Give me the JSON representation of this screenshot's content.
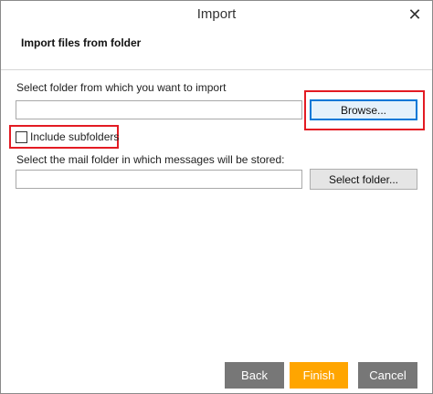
{
  "window": {
    "title": "Import",
    "close_glyph": "✕"
  },
  "page": {
    "heading": "Import files from folder"
  },
  "source": {
    "label": "Select folder from which you want to import",
    "value": "",
    "browse_label": "Browse..."
  },
  "subfolders": {
    "label": "Include subfolders",
    "checked": false
  },
  "target": {
    "label": "Select the mail folder in which messages will be stored:",
    "value": "",
    "select_label": "Select folder..."
  },
  "footer": {
    "back_label": "Back",
    "finish_label": "Finish",
    "cancel_label": "Cancel"
  },
  "colors": {
    "highlight": "#e31b23",
    "focus_border": "#0078d7",
    "finish": "#ffa500",
    "secondary_button": "#777777"
  },
  "icons": {
    "close": "close-icon",
    "checkbox": "checkbox-icon"
  }
}
